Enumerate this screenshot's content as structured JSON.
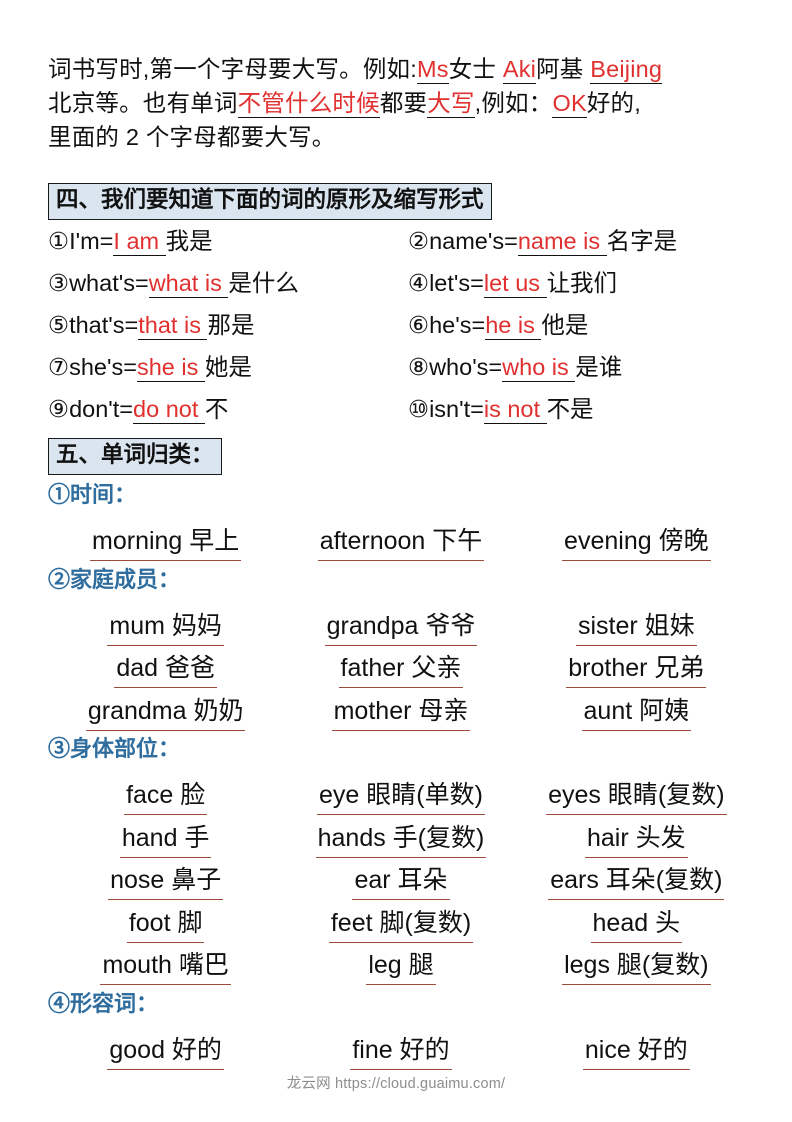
{
  "intro": {
    "line1_a": "词书写时,第一个字母要大写。例如:",
    "line1_ms": "Ms",
    "line1_b": "女士",
    "line1_aki": "Aki",
    "line1_c": "阿基",
    "line1_beijing": "Beijing",
    "line2_a": "北京等。也有单词",
    "line2_r1": "不管什么时候",
    "line2_b": "都要",
    "line2_r2": "大写",
    "line2_c": ",例如：",
    "line2_ok": "OK",
    "line2_d": "好的,",
    "line3": "里面的 2 个字母都要大写。"
  },
  "section4": {
    "heading": "四、我们要知道下面的词的原形及缩写形式",
    "items": [
      {
        "num": "①",
        "short": "I'm=",
        "full": "I am ",
        "cn": "我是"
      },
      {
        "num": "②",
        "short": "name's=",
        "full": "name is ",
        "cn": "名字是"
      },
      {
        "num": "③",
        "short": "what's=",
        "full": "what is ",
        "cn": "是什么"
      },
      {
        "num": "④",
        "short": "let's=",
        "full": "let us ",
        "cn": "让我们"
      },
      {
        "num": "⑤",
        "short": "that's=",
        "full": "that is ",
        "cn": "那是"
      },
      {
        "num": "⑥",
        "short": "he's=",
        "full": "he is ",
        "cn": "他是"
      },
      {
        "num": "⑦",
        "short": "she's=",
        "full": "she is ",
        "cn": "她是"
      },
      {
        "num": "⑧",
        "short": "who's=",
        "full": "who is ",
        "cn": "是谁"
      },
      {
        "num": "⑨",
        "short": "don't=",
        "full": "do not ",
        "cn": "不"
      },
      {
        "num": "⑩",
        "short": "isn't=",
        "full": "is not ",
        "cn": "不是"
      }
    ]
  },
  "section5": {
    "heading": "五、单词归类：",
    "categories": [
      {
        "label": "①时间：",
        "rows": [
          [
            "morning 早上",
            "afternoon 下午",
            "evening 傍晚"
          ]
        ]
      },
      {
        "label": "②家庭成员：",
        "rows": [
          [
            "mum 妈妈",
            "grandpa 爷爷",
            "sister 姐妹"
          ],
          [
            "dad 爸爸",
            "father 父亲",
            "brother 兄弟"
          ],
          [
            "grandma 奶奶",
            "mother 母亲",
            "aunt 阿姨"
          ]
        ]
      },
      {
        "label": "③身体部位：",
        "rows": [
          [
            "face 脸",
            "eye 眼睛(单数)",
            "eyes 眼睛(复数)"
          ],
          [
            "hand 手",
            "hands 手(复数)",
            "hair 头发"
          ],
          [
            "nose 鼻子",
            "ear 耳朵",
            "ears 耳朵(复数)"
          ],
          [
            "foot 脚",
            "feet 脚(复数)",
            "head 头"
          ],
          [
            "mouth 嘴巴",
            "leg 腿",
            "legs 腿(复数)"
          ]
        ]
      },
      {
        "label": "④形容词：",
        "rows": [
          [
            "good 好的",
            "fine 好的",
            "nice 好的"
          ]
        ]
      }
    ]
  },
  "watermark": {
    "text": "龙云网 https://cloud.guaimu.com/"
  },
  "colors": {
    "red": "#e0302f",
    "blue": "#2e6d9e",
    "underline_brown": "#9c4a3c",
    "header_bg": "#dae5ef",
    "text": "#111111",
    "watermark": "#8d8d8d"
  }
}
